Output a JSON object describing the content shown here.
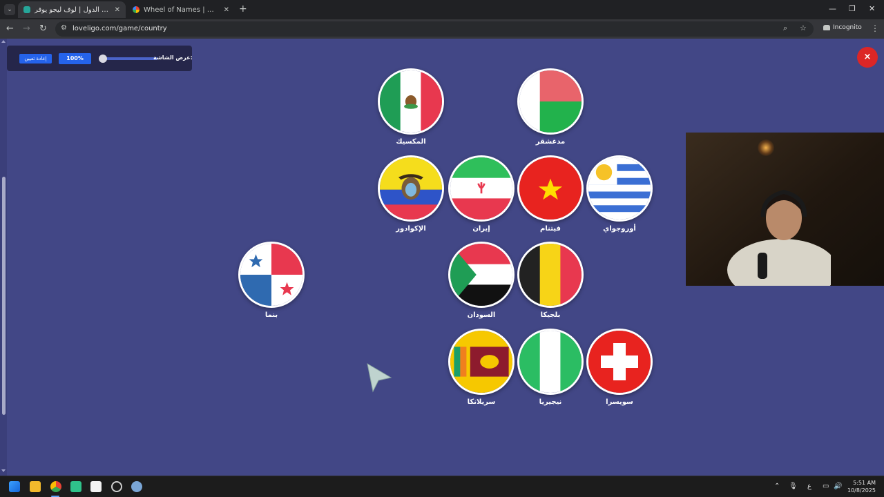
{
  "browser": {
    "tabs": [
      {
        "title": "لعبة حرب الدول | لوف ليجو يوفر",
        "active": true
      },
      {
        "title": "Wheel of Names | اسم العشوائي",
        "active": false
      }
    ],
    "url": "loveligo.com/game/country",
    "mode_label": "Incognito"
  },
  "game": {
    "zoom_label": "عرض الشاشة:",
    "zoom_value": "100%",
    "reset_label": "إعادة تعيين",
    "close_glyph": "×",
    "countries": [
      {
        "id": "mexico",
        "name": "المكسيك"
      },
      {
        "id": "madagascar",
        "name": "مدغشقر"
      },
      {
        "id": "ecuador",
        "name": "الإكوادور"
      },
      {
        "id": "iran",
        "name": "إيران"
      },
      {
        "id": "vietnam",
        "name": "فيتنام"
      },
      {
        "id": "uruguay",
        "name": "أوروجواي"
      },
      {
        "id": "panama",
        "name": "بنما"
      },
      {
        "id": "sudan",
        "name": "السودان"
      },
      {
        "id": "belgium",
        "name": "بلجيكا"
      },
      {
        "id": "srilanka",
        "name": "سريلانكا"
      },
      {
        "id": "nigeria",
        "name": "نيجيريا"
      },
      {
        "id": "switzerland",
        "name": "سويسرا"
      }
    ]
  },
  "taskbar": {
    "time": "5:51 AM",
    "date": "10/8/2025",
    "input_language": "ع"
  },
  "icons": [
    "windows-start-icon",
    "file-explorer-icon",
    "chrome-icon",
    "search-icon",
    "star-icon",
    "microphone-icon",
    "speaker-icon",
    "settings-icon"
  ]
}
